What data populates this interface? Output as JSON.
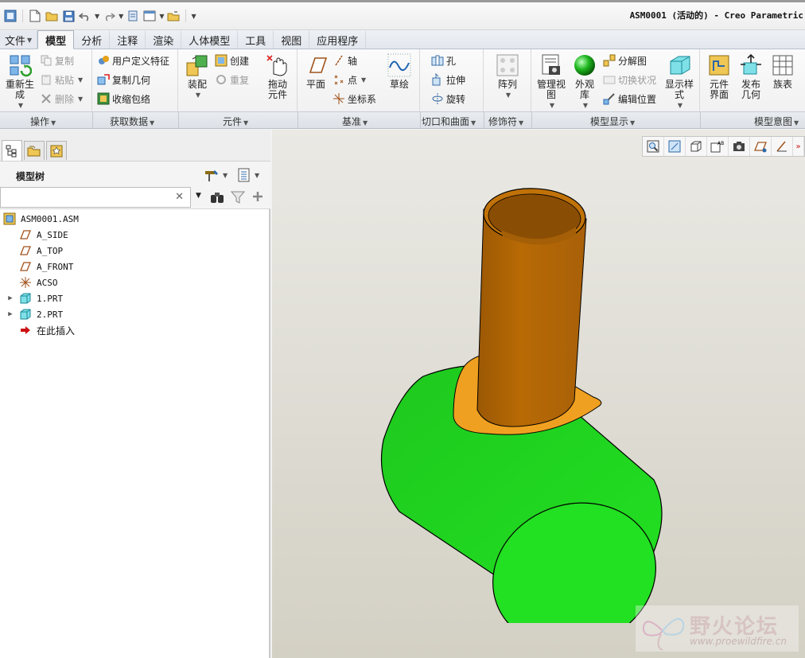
{
  "window": {
    "title": "ASM0001 (活动的) - Creo Parametric"
  },
  "tabs": [
    {
      "label": "文件",
      "has_dropdown": true
    },
    {
      "label": "模型",
      "active": true
    },
    {
      "label": "分析"
    },
    {
      "label": "注释"
    },
    {
      "label": "渲染"
    },
    {
      "label": "人体模型"
    },
    {
      "label": "工具"
    },
    {
      "label": "视图"
    },
    {
      "label": "应用程序"
    }
  ],
  "ribbon": {
    "operations": {
      "regenerate": "重新生成",
      "copy": "复制",
      "paste": "粘贴",
      "delete": "删除",
      "group_label": "操作"
    },
    "get_data": {
      "udf": "用户定义特征",
      "copy_geom": "复制几何",
      "shrinkwrap": "收缩包络",
      "group_label": "获取数据"
    },
    "component": {
      "assemble": "装配",
      "create": "创建",
      "repeat": "重复",
      "drag": "拖动元件",
      "group_label": "元件"
    },
    "datum": {
      "plane": "平面",
      "axis": "轴",
      "point": "点",
      "csys": "坐标系",
      "sketch": "草绘",
      "group_label": "基准"
    },
    "cut_surface": {
      "hole": "孔",
      "extrude": "拉伸",
      "revolve": "旋转",
      "group_label": "切口和曲面"
    },
    "modifiers": {
      "pattern": "阵列",
      "group_label": "修饰符"
    },
    "model_display": {
      "manage_views": "管理视图",
      "appearance": "外观库",
      "explode": "分解图",
      "toggle_status": "切换状况",
      "edit_position": "编辑位置",
      "display_style": "显示样式",
      "group_label": "模型显示"
    },
    "model_intent": {
      "component_interface": "元件界面",
      "publish_geom": "发布几何",
      "family_table": "族表",
      "group_label": "模型意图"
    }
  },
  "model_tree": {
    "title": "模型树",
    "search_placeholder": "",
    "nodes": [
      {
        "label": "ASM0001.ASM",
        "icon": "assembly-icon",
        "level": 0
      },
      {
        "label": "A_SIDE",
        "icon": "datum-plane-icon",
        "level": 1
      },
      {
        "label": "A_TOP",
        "icon": "datum-plane-icon",
        "level": 1
      },
      {
        "label": "A_FRONT",
        "icon": "datum-plane-icon",
        "level": 1
      },
      {
        "label": "ACSO",
        "icon": "csys-icon",
        "level": 1
      },
      {
        "label": "1.PRT",
        "icon": "part-icon",
        "level": 1,
        "expandable": true
      },
      {
        "label": "2.PRT",
        "icon": "part-icon",
        "level": 1,
        "expandable": true
      },
      {
        "label": "在此插入",
        "icon": "insert-arrow-icon",
        "level": 1
      }
    ]
  },
  "watermark": {
    "title": "野火论坛",
    "url": "www.proewildfire.cn"
  },
  "colors": {
    "cylinder_green": "#22dd22",
    "tube_brown": "#b86a05",
    "pad_orange": "#f0a020",
    "viewport_bg": "#dedcd3"
  }
}
